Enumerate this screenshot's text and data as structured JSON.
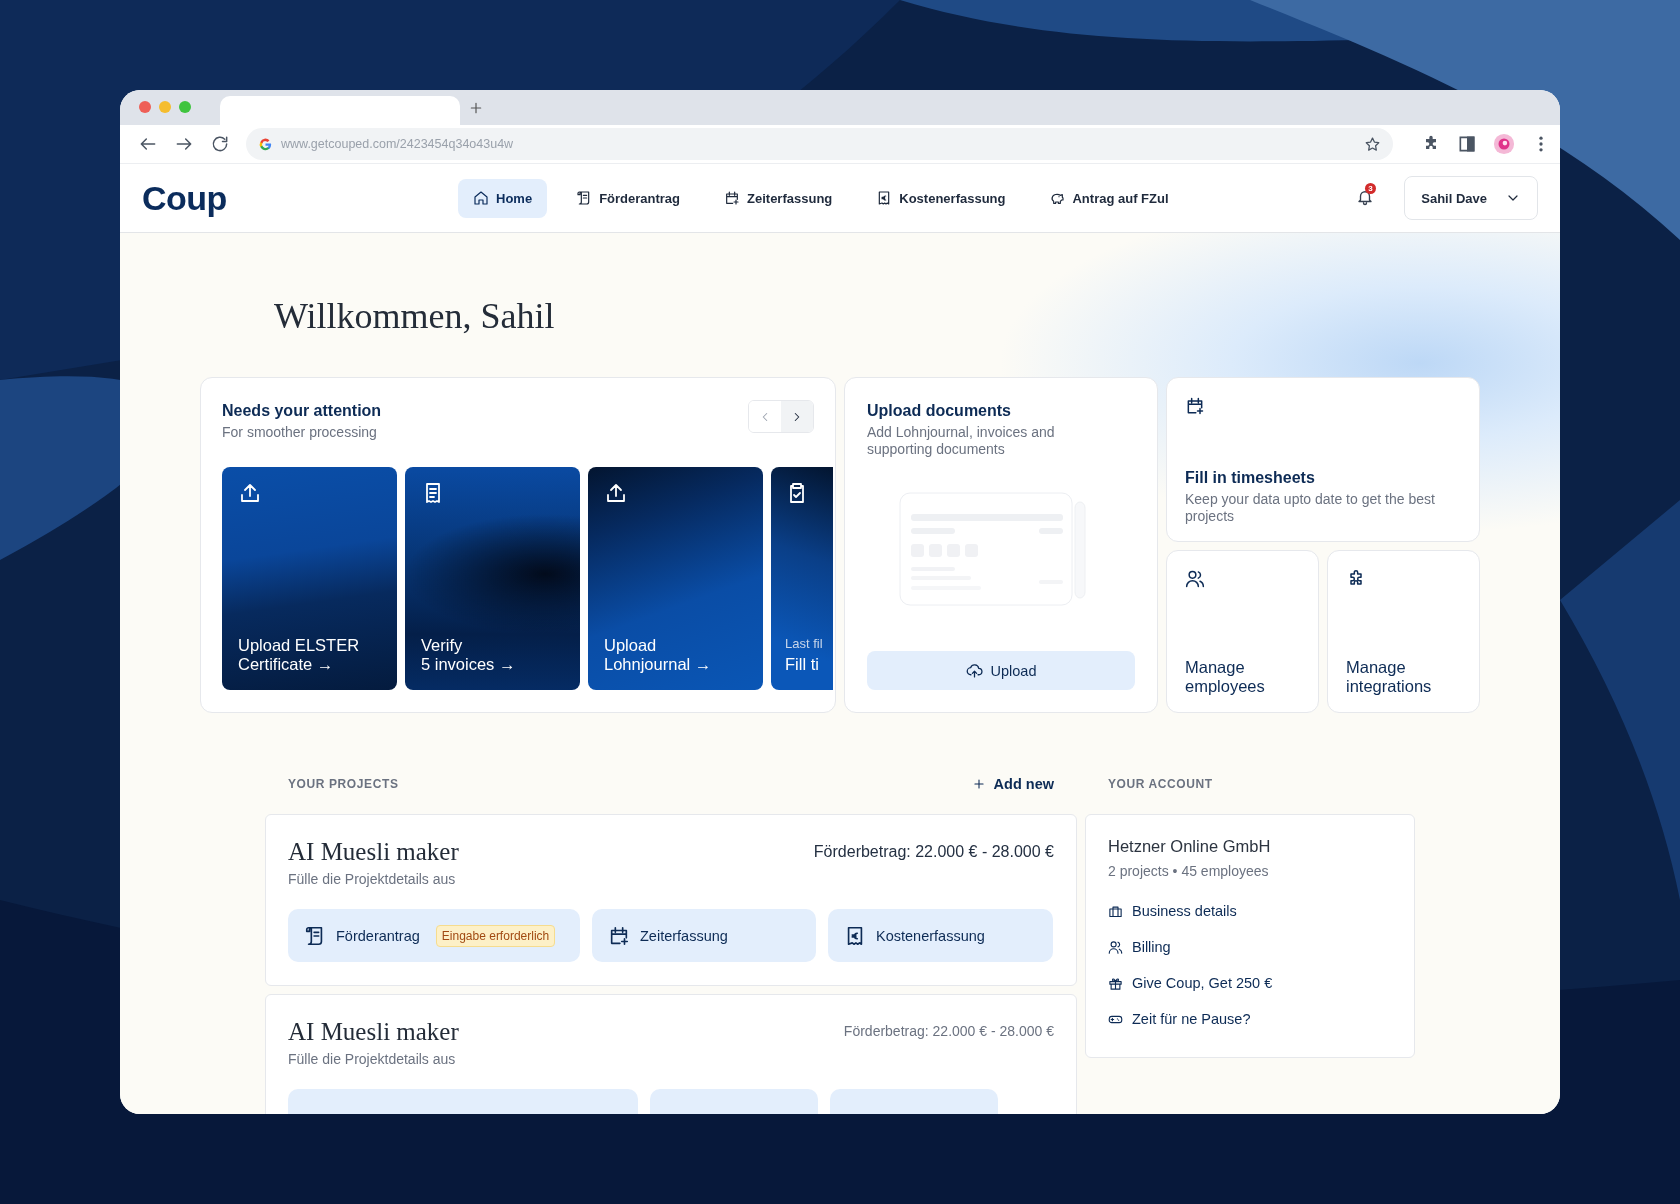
{
  "browser": {
    "url": "www.getcouped.com/2423454q34o43u4w"
  },
  "app": {
    "logo": "Coup",
    "nav": [
      {
        "label": "Home",
        "selected": true
      },
      {
        "label": "Förderantrag",
        "selected": false
      },
      {
        "label": "Zeiterfassung",
        "selected": false
      },
      {
        "label": "Kostenerfassung",
        "selected": false
      },
      {
        "label": "Antrag auf FZul",
        "selected": false
      }
    ],
    "notification_count": "3",
    "user": "Sahil Dave"
  },
  "greeting": "Willkommen, Sahil",
  "attention": {
    "title": "Needs your attention",
    "subtitle": "For smoother processing",
    "tiles": [
      {
        "lines": [
          "Upload ELSTER",
          "Certificate →"
        ]
      },
      {
        "lines": [
          "Verify",
          "5 invoices →"
        ]
      },
      {
        "lines": [
          "Upload",
          "Lohnjournal →"
        ]
      },
      {
        "eyebrow": "Last fil",
        "lines": [
          "Fill ti"
        ]
      }
    ]
  },
  "upload_card": {
    "title": "Upload documents",
    "subtitle": "Add Lohnjournal, invoices and supporting documents",
    "button": "Upload"
  },
  "shortcuts": [
    {
      "title": "Fill in timesheets",
      "subtitle": "Keep your data upto date to get the best projects"
    },
    {
      "title": "Manage employees"
    },
    {
      "title": "Manage integrations"
    }
  ],
  "projects": {
    "heading": "YOUR PROJECTS",
    "add_label": "Add new",
    "items": [
      {
        "name": "AI Muesli maker",
        "subtitle": "Fülle die Projektdetails aus",
        "funding": "Förderbetrag: 22.000 € - 28.000 €",
        "emphasized": true,
        "actions": [
          {
            "label": "Förderantrag",
            "badge": "Eingabe erforderlich"
          },
          {
            "label": "Zeiterfassung"
          },
          {
            "label": "Kostenerfassung"
          }
        ]
      },
      {
        "name": "AI Muesli maker",
        "subtitle": "Fülle die Projektdetails aus",
        "funding": "Förderbetrag: 22.000 € - 28.000 €",
        "emphasized": false
      }
    ]
  },
  "account": {
    "heading": "YOUR ACCOUNT",
    "company": "Hetzner Online GmbH",
    "summary": "2 projects • 45 employees",
    "links": [
      "Business details",
      "Billing",
      "Give Coup, Get 250 €",
      "Zeit für ne Pause?"
    ]
  }
}
